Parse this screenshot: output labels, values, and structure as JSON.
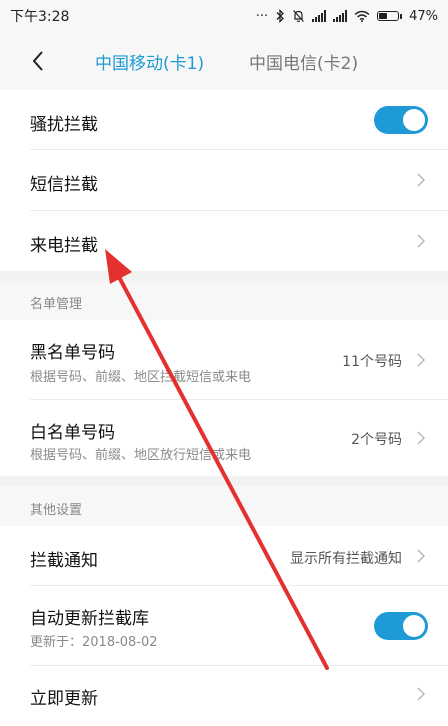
{
  "status_bar": {
    "time": "下午3:28",
    "dots": "···",
    "battery": "47%",
    "battery_level": 0.47
  },
  "header": {
    "tabs": [
      {
        "label": "中国移动(卡1)",
        "active": true
      },
      {
        "label": "中国电信(卡2)",
        "active": false
      }
    ]
  },
  "intercept": {
    "harass": {
      "label": "骚扰拦截",
      "enabled": true
    },
    "sms": {
      "label": "短信拦截"
    },
    "call": {
      "label": "来电拦截"
    }
  },
  "lists": {
    "section_label": "名单管理",
    "blacklist": {
      "title": "黑名单号码",
      "subtitle": "根据号码、前缀、地区拦截短信或来电",
      "count": "11个号码"
    },
    "whitelist": {
      "title": "白名单号码",
      "subtitle": "根据号码、前缀、地区放行短信或来电",
      "count": "2个号码"
    }
  },
  "other": {
    "section_label": "其他设置",
    "notify": {
      "title": "拦截通知",
      "value": "显示所有拦截通知"
    },
    "auto_update": {
      "title": "自动更新拦截库",
      "subtitle": "更新于：2018-08-02",
      "enabled": true
    },
    "update_now": {
      "title": "立即更新"
    }
  },
  "colors": {
    "accent": "#1e9ad6",
    "annotation_arrow": "#e53030"
  }
}
